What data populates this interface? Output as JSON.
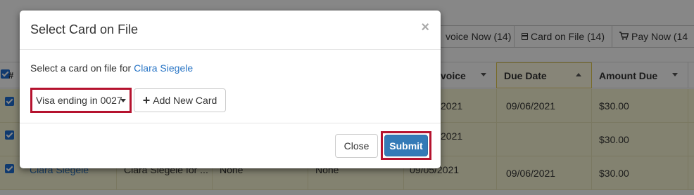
{
  "background": {
    "toolbar": {
      "invoice_now": "voice Now (14)",
      "card_on_file": "Card on File (14)",
      "pay_now": "Pay Now (14"
    },
    "table": {
      "hash_header": "#",
      "headers": {
        "invoice": "voice",
        "due_date": "Due Date",
        "amount_due": "Amount Due"
      },
      "rows": [
        {
          "invoice": "2021",
          "due_date": "09/06/2021",
          "amount_due": "$30.00"
        },
        {
          "invoice": "2021",
          "due_date": "",
          "amount_due": "$30.00"
        },
        {
          "client": "Clara Siegele",
          "description": "Clara Siegele for ...",
          "col3": "None",
          "col4": "None",
          "invoice": "09/05/2021",
          "due_date": "09/06/2021",
          "amount_due": "$30.00"
        }
      ]
    }
  },
  "modal": {
    "title": "Select Card on File",
    "close_symbol": "×",
    "prompt_text": "Select a card on file for ",
    "client_name": "Clara Siegele",
    "card_select": {
      "selected": "Visa ending in 0027"
    },
    "add_card_button": "Add New Card",
    "close_button": "Close",
    "submit_button": "Submit"
  },
  "colors": {
    "highlight": "#b5122e",
    "primary": "#337ab7",
    "link": "#2a76c6",
    "row_highlight": "#f8f6d4"
  }
}
